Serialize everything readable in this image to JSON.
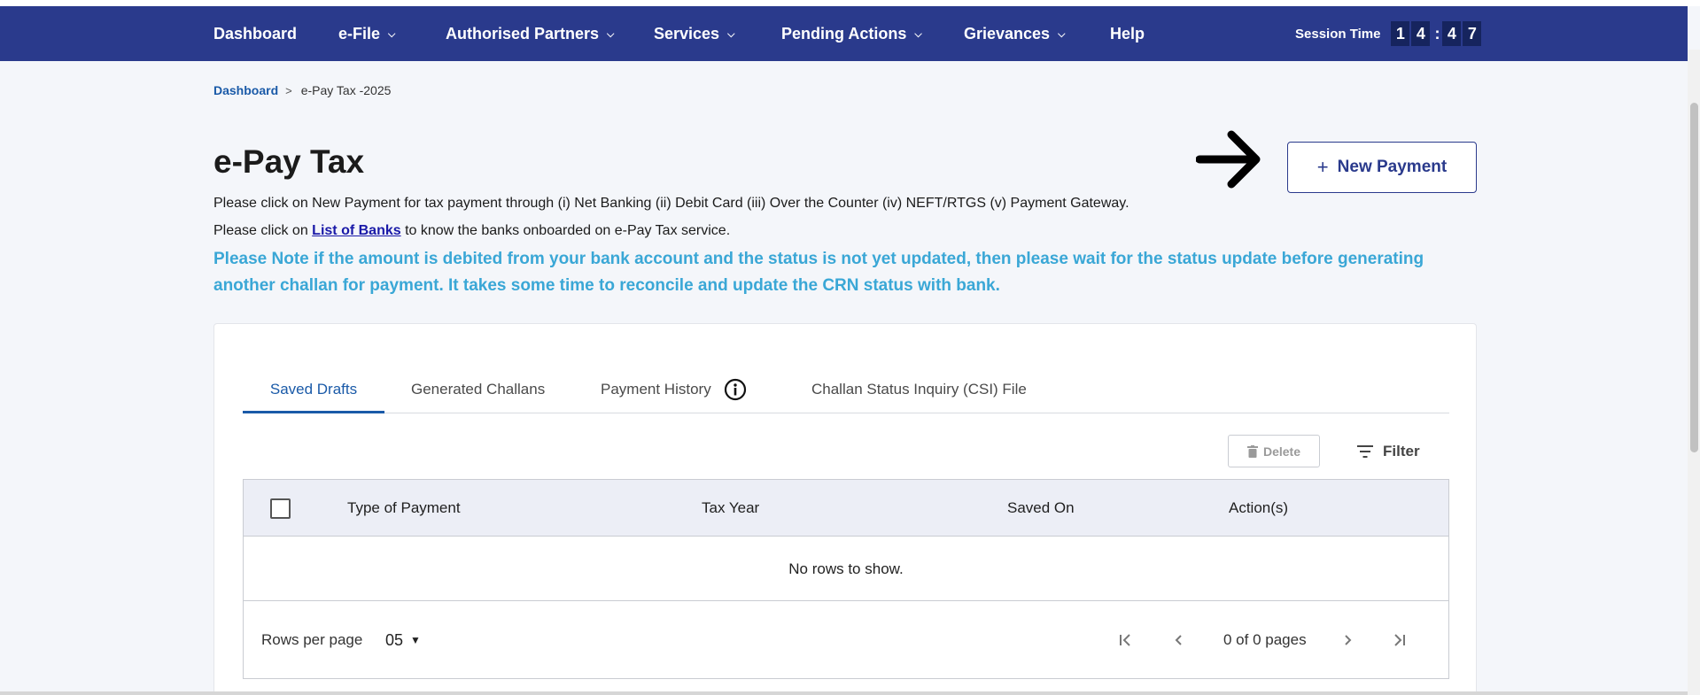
{
  "nav": {
    "items": [
      {
        "label": "Dashboard"
      },
      {
        "label": "e-File",
        "caret": "chevron-down-icon"
      },
      {
        "label": "Authorised Partners",
        "caret": "chevron-down-icon"
      },
      {
        "label": "Services",
        "caret": "chevron-down-icon"
      },
      {
        "label": "Pending Actions",
        "caret": "chevron-down-icon"
      },
      {
        "label": "Grievances",
        "caret": "chevron-down-icon"
      },
      {
        "label": "Help"
      }
    ],
    "session": {
      "label": "Session Time",
      "digits": [
        "1",
        "4",
        "4",
        "7"
      ],
      "separator": ":"
    }
  },
  "breadcrumb": {
    "home": "Dashboard",
    "separator": ">",
    "current": "e-Pay Tax -2025"
  },
  "page": {
    "title": "e-Pay Tax",
    "info1": "Please click on New Payment for tax payment through (i) Net Banking (ii) Debit Card (iii) Over the Counter (iv) NEFT/RTGS (v) Payment Gateway.",
    "info2_prefix": "Please click on",
    "info2_link": "List of Banks",
    "info2_suffix": "to know the banks onboarded on e-Pay Tax service.",
    "note": "Please Note if the amount is debited from your bank account and the status is not yet updated, then please wait for the status update before generating another challan for payment. It takes some time to reconcile and update the CRN status with bank.",
    "new_payment_icon": "+",
    "new_payment_label": "New Payment"
  },
  "tabs": [
    {
      "label": "Saved Drafts",
      "active": true
    },
    {
      "label": "Generated Challans"
    },
    {
      "label": "Payment History",
      "icon": "info-icon"
    },
    {
      "label": "Challan Status Inquiry (CSI) File"
    }
  ],
  "toolbar": {
    "delete_label": "Delete",
    "filter_label": "Filter"
  },
  "table": {
    "columns": [
      "Type of Payment",
      "Tax Year",
      "Saved On",
      "Action(s)"
    ],
    "empty_message": "No rows to show.",
    "rows_per_page_label": "Rows per page",
    "rows_per_page_value": "05",
    "pager_text": "0 of 0 pages"
  },
  "colors": {
    "nav_bg": "#2a3a8c",
    "accent": "#1a5aa8",
    "note": "#3aa7d6"
  }
}
